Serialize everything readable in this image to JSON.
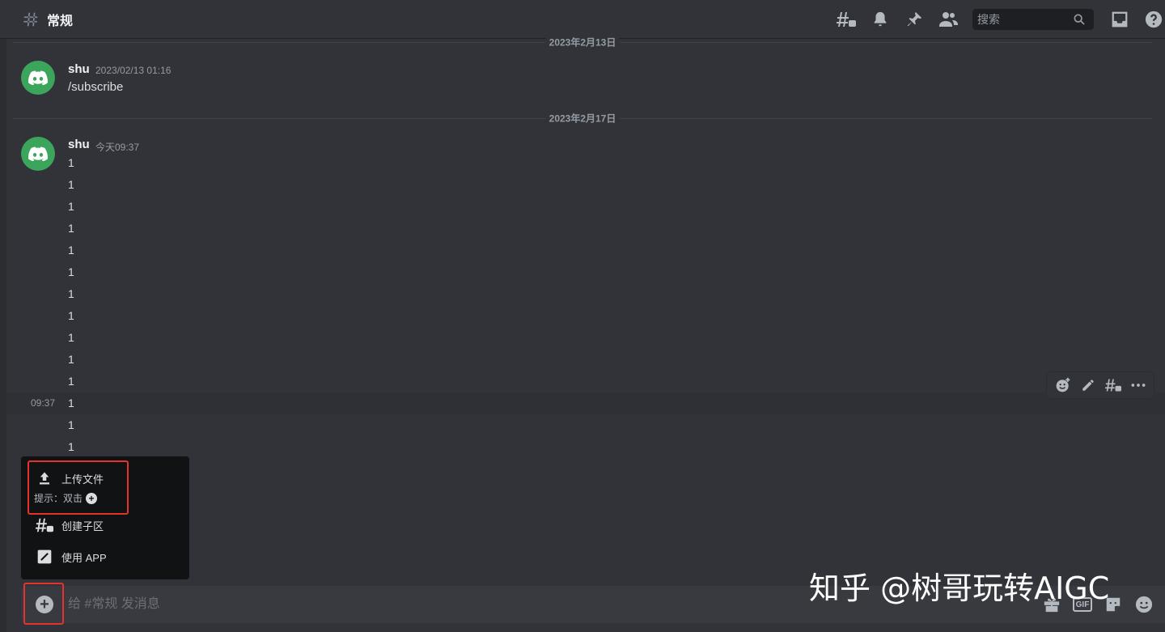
{
  "header": {
    "channel_title": "常规",
    "search_placeholder": "搜索",
    "icons": [
      "threads-icon",
      "bell-icon",
      "pin-icon",
      "members-icon",
      "search-icon",
      "inbox-icon",
      "help-icon"
    ]
  },
  "dividers": [
    {
      "label": "2023年2月13日"
    },
    {
      "label": "2023年2月17日"
    }
  ],
  "messages": [
    {
      "author": "shu",
      "timestamp": "2023/02/13 01:16",
      "text": "/subscribe"
    },
    {
      "author": "shu",
      "timestamp": "今天09:37",
      "lines": [
        "1",
        "1",
        "1",
        "1",
        "1",
        "1",
        "1",
        "1",
        "1",
        "1",
        "1",
        "1",
        "1",
        "1"
      ],
      "hover_timestamp": "09:37"
    }
  ],
  "popup_menu": {
    "items": [
      {
        "label": "上传文件",
        "icon": "upload-icon"
      },
      {
        "label": "创建子区",
        "icon": "thread-icon"
      },
      {
        "label": "使用 APP",
        "icon": "app-icon"
      }
    ],
    "hint_text": "提示：双击",
    "hint_glyph": "+"
  },
  "composer": {
    "placeholder": "给 #常规 发消息",
    "plus_glyph": "+",
    "gif_label": "GIF",
    "icons": [
      "gift-icon",
      "gif-icon",
      "sticker-icon",
      "emoji-icon"
    ]
  },
  "watermark": "知乎 @树哥玩转AIGC",
  "colors": {
    "background": "#313338",
    "avatar": "#3ba55c",
    "highlight": "#e5322d"
  }
}
